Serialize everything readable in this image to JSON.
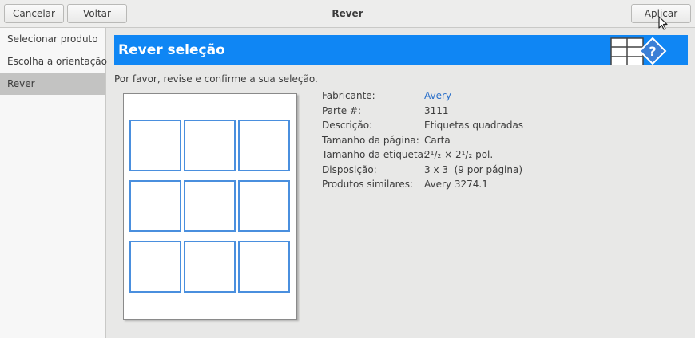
{
  "header": {
    "cancel_label": "Cancelar",
    "back_label": "Voltar",
    "title": "Rever",
    "apply_label": "Aplicar"
  },
  "sidebar": {
    "items": [
      {
        "label": "Selecionar produto",
        "active": false
      },
      {
        "label": "Escolha a orientação",
        "active": false
      },
      {
        "label": "Rever",
        "active": true
      }
    ]
  },
  "main": {
    "banner_title": "Rever seleção",
    "instructions": "Por favor, revise e confirme a sua seleção.",
    "details": [
      {
        "key": "Fabricante:",
        "value": "Avery"
      },
      {
        "key": "Parte #:",
        "value": "3111"
      },
      {
        "key": "Descrição:",
        "value": "Etiquetas quadradas"
      },
      {
        "key": "Tamanho da página:",
        "value": "Carta"
      },
      {
        "key": "Tamanho da etiqueta:",
        "value": "2¹/₂ × 2¹/₂ pol."
      },
      {
        "key": "Disposição:",
        "value": "3 x 3  (9 por página)"
      },
      {
        "key": "Produtos similares:",
        "value": "Avery 3274.1"
      }
    ]
  },
  "colors": {
    "banner": "#0f86f4",
    "label_border": "#4a8fde",
    "link": "#2a6fc9",
    "sidebar_active": "#c3c3c2"
  }
}
